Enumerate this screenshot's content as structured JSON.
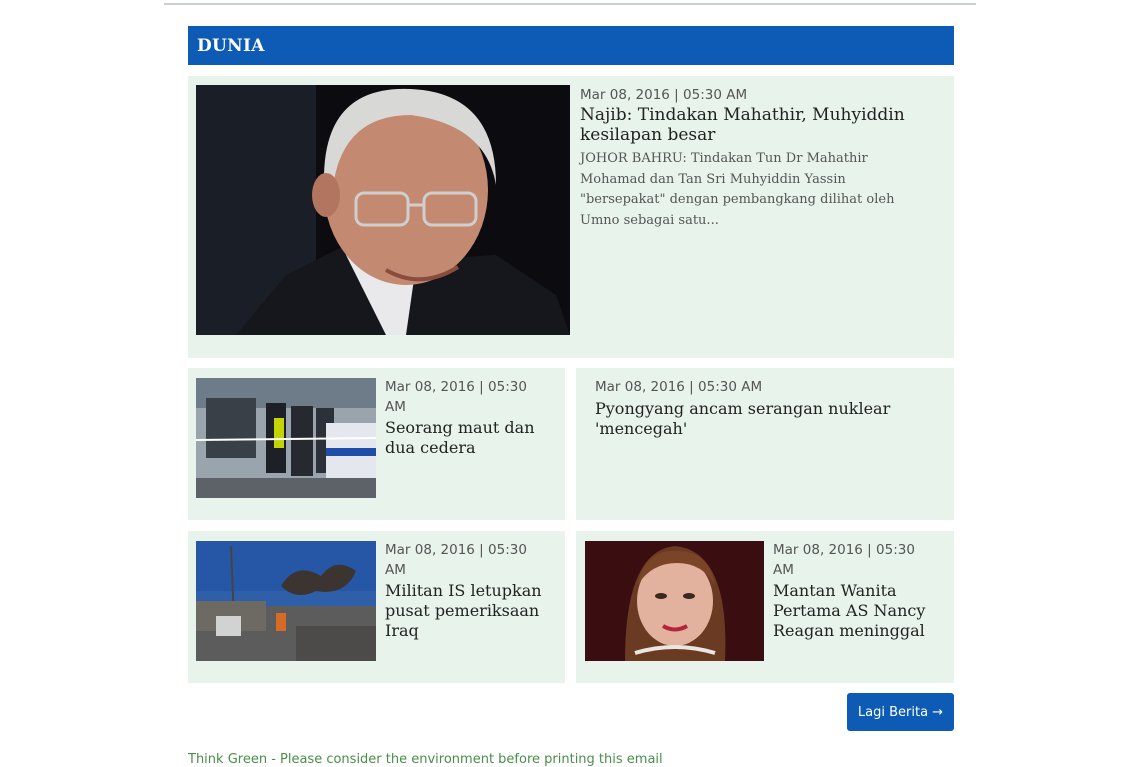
{
  "section": {
    "title": "DUNIA"
  },
  "featured": {
    "date": "Mar 08, 2016 | 05:30 AM",
    "headline": "Najib: Tindakan Mahathir, Muhyiddin kesilapan besar",
    "excerpt": "JOHOR BAHRU: Tindakan Tun Dr Mahathir Mohamad dan Tan Sri Muhyiddin Yassin \"bersepakat\" dengan pembangkang dilihat oleh Umno sebagai satu...",
    "image": "portrait-photo"
  },
  "articles": [
    {
      "date": "Mar 08, 2016 | 05:30 AM",
      "headline": "Seorang maut dan dua cedera",
      "image": "crime-scene-photo"
    },
    {
      "date": "Mar 08, 2016 | 05:30 AM",
      "headline": "Pyongyang ancam serangan nuklear 'mencegah'"
    },
    {
      "date": "Mar 08, 2016 | 05:30 AM",
      "headline": "Militan IS letupkan pusat pemeriksaan Iraq",
      "image": "explosion-photo"
    },
    {
      "date": "Mar 08, 2016 | 05:30 AM",
      "headline": "Mantan Wanita Pertama AS Nancy Reagan meninggal",
      "image": "woman-portrait-photo"
    }
  ],
  "more_button": {
    "label": "Lagi Berita →"
  },
  "footer": {
    "note": "Think Green - Please consider the environment before printing this email"
  },
  "colors": {
    "accent": "#0d5bb5",
    "card_bg": "#e8f3ec"
  }
}
